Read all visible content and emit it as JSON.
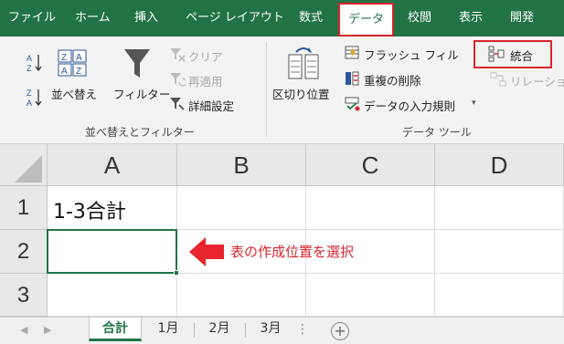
{
  "ribbon_tabs": [
    "ファイル",
    "ホーム",
    "挿入",
    "ページ レイアウト",
    "数式",
    "データ",
    "校閲",
    "表示",
    "開発"
  ],
  "active_tab": "データ",
  "sort_filter": {
    "sort_label": "並べ替え",
    "filter_label": "フィルター",
    "clear_label": "クリア",
    "reapply_label": "再適用",
    "advanced_label": "詳細設定",
    "group_label": "並べ替えとフィルター"
  },
  "data_tools": {
    "text_to_columns_label": "区切り位置",
    "flash_fill_label": "フラッシュ フィル",
    "remove_duplicates_label": "重複の削除",
    "data_validation_label": "データの入力規則",
    "consolidate_label": "統合",
    "relationships_label": "リレーション",
    "group_label": "データ ツール"
  },
  "grid": {
    "columns": [
      "A",
      "B",
      "C",
      "D"
    ],
    "rows": [
      "1",
      "2",
      "3"
    ],
    "a1": "1-3合計"
  },
  "annotation": "表の作成位置を選択",
  "sheets": [
    "合計",
    "1月",
    "2月",
    "3月"
  ],
  "colors": {
    "excel_green": "#217346",
    "highlight_red": "#d7252c"
  }
}
